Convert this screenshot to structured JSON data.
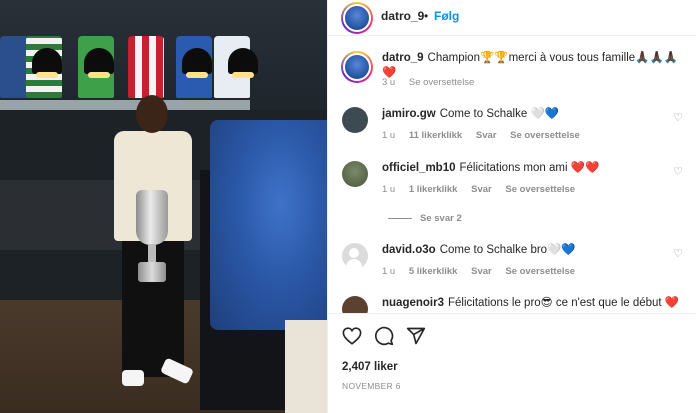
{
  "post": {
    "username": "datro_9",
    "separator": "•",
    "follow_label": "Følg"
  },
  "caption": {
    "username": "datro_9",
    "text": "Champion🏆🏆merci à vous tous famille🙏🏿🙏🏿🙏🏿❤️",
    "time": "3 u",
    "translate": "Se oversettelse"
  },
  "comments": [
    {
      "username": "jamiro.gw",
      "text": "Come to Schalke 🤍💙",
      "time": "1 u",
      "likes": "11 likerklikk",
      "reply": "Svar",
      "translate": "Se oversettelse"
    },
    {
      "username": "officiel_mb10",
      "text": "Félicitations mon ami ❤️❤️",
      "time": "1 u",
      "likes": "1 likerklikk",
      "reply": "Svar",
      "translate": "Se oversettelse",
      "view_replies": "Se svar 2"
    },
    {
      "username": "david.o3o",
      "text": "Come to Schalke bro🤍💙",
      "time": "1 u",
      "likes": "5 likerklikk",
      "reply": "Svar",
      "translate": "Se oversettelse"
    },
    {
      "username": "nuagenoir3",
      "text": "Félicitations le pro😎 ce n'est que le début ❤️"
    }
  ],
  "actions": {
    "icons": [
      "heart-icon",
      "comment-icon",
      "share-icon"
    ],
    "likes": "2,407 liker",
    "date": "NOVEMBER 6"
  },
  "colors": {
    "link_blue": "#0095f6",
    "muted": "#8e8e8e",
    "text": "#262626",
    "heart_red": "#ed4956"
  }
}
